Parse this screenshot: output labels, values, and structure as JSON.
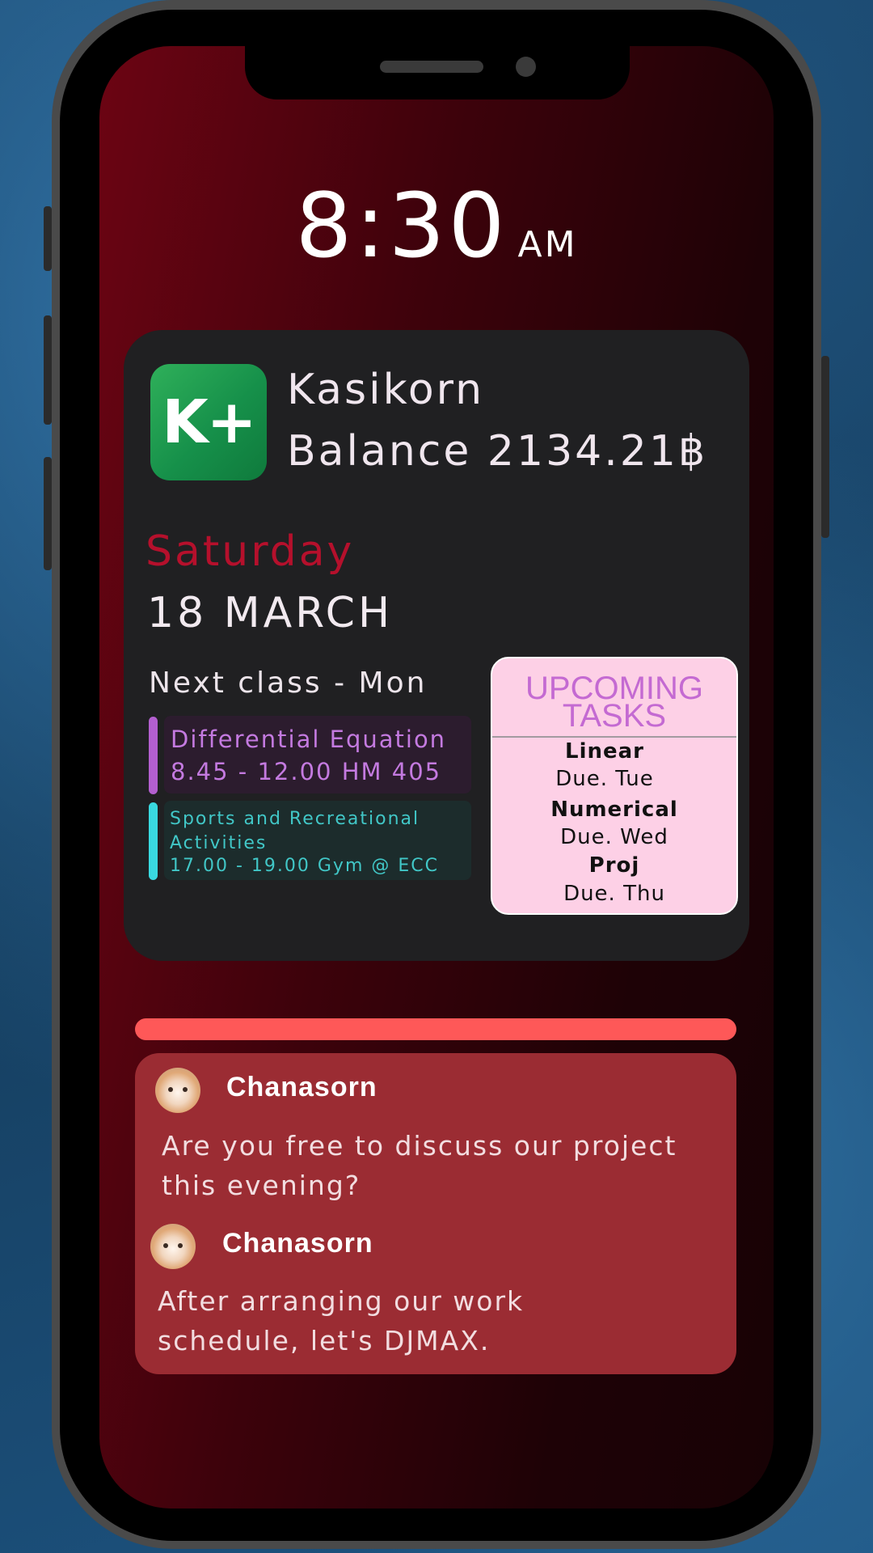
{
  "lockscreen": {
    "time": "8:30",
    "ampm": "AM"
  },
  "bank": {
    "icon_text": "K+",
    "name": "Kasikorn",
    "balance": "Balance 2134.21฿"
  },
  "date": {
    "day": "Saturday",
    "date": "18 MARCH"
  },
  "schedule": {
    "heading": "Next class - Mon",
    "classes": [
      {
        "title": "Differential Equation",
        "details": "8.45 - 12.00 HM 405",
        "color": "#c47ae0"
      },
      {
        "title": "Sports and Recreational Activities",
        "details": "17.00 - 19.00 Gym @ ECC",
        "color": "#41c7c7"
      }
    ]
  },
  "tasks": {
    "title_line1": "UPCOMING",
    "title_line2": "TASKS",
    "items": [
      {
        "name": "Linear",
        "due": "Due. Tue"
      },
      {
        "name": "Numerical",
        "due": "Due. Wed"
      },
      {
        "name": "Proj",
        "due": "Due. Thu"
      }
    ]
  },
  "notifications": [
    {
      "sender": "Chanasorn",
      "message_line1": "Are you free to discuss our project",
      "message_line2": "this evening?"
    },
    {
      "sender": "Chanasorn",
      "message_line1": "After arranging our work",
      "message_line2": "schedule, let's DJMAX."
    }
  ],
  "colors": {
    "accent_day": "#b5102c",
    "notif_bar": "#fe5858",
    "notif_box": "#9b2c33",
    "tasks_bg": "#fdd0e6"
  }
}
